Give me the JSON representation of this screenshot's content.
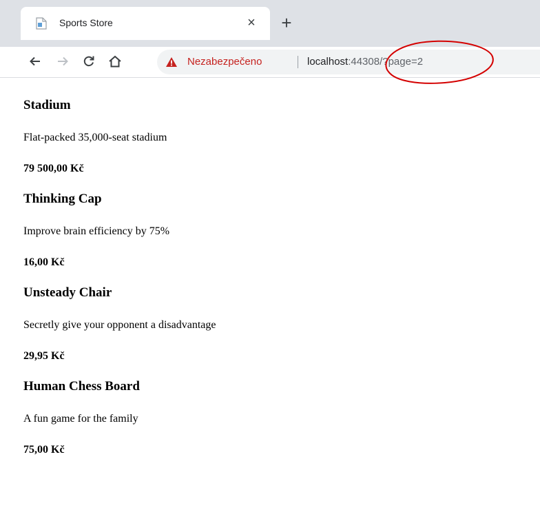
{
  "browser": {
    "tab": {
      "title": "Sports Store",
      "close_glyph": "×",
      "favicon": "document-icon"
    },
    "new_tab_glyph": "+",
    "nav": {
      "back": "←",
      "forward": "→",
      "reload": "C",
      "home": "home-icon"
    },
    "address_bar": {
      "security_label": "Nezabezpečeno",
      "security_icon": "warning-icon",
      "security_color": "#c5221f",
      "url_host": "localhost",
      "url_rest": ":44308/?page=2"
    },
    "annotation_color": "#d40000"
  },
  "products": [
    {
      "name": "Stadium",
      "description": "Flat-packed 35,000-seat stadium",
      "price": "79 500,00 Kč"
    },
    {
      "name": "Thinking Cap",
      "description": "Improve brain efficiency by 75%",
      "price": "16,00 Kč"
    },
    {
      "name": "Unsteady Chair",
      "description": "Secretly give your opponent a disadvantage",
      "price": "29,95 Kč"
    },
    {
      "name": "Human Chess Board",
      "description": "A fun game for the family",
      "price": "75,00 Kč"
    }
  ]
}
